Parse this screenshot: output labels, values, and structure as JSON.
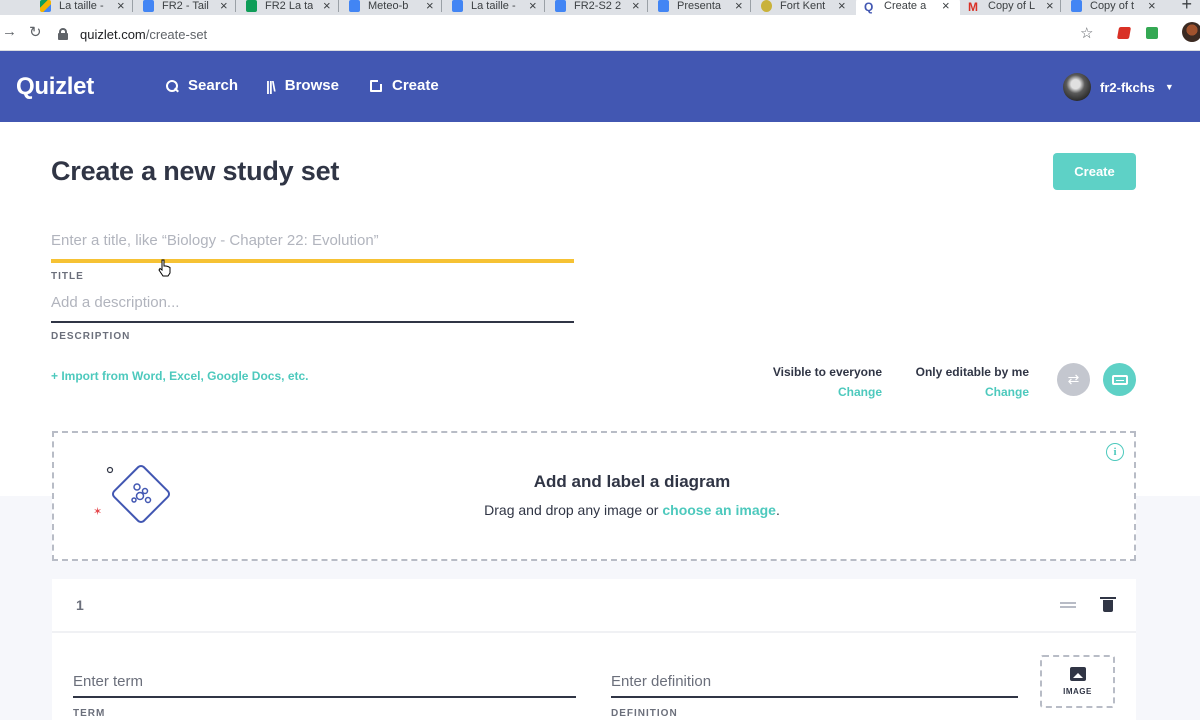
{
  "browser": {
    "tabs": [
      {
        "title": "La taille -",
        "icon": "drive"
      },
      {
        "title": "FR2 - Tail",
        "icon": "docs"
      },
      {
        "title": "FR2 La ta",
        "icon": "sheets"
      },
      {
        "title": "Meteo-b",
        "icon": "docs"
      },
      {
        "title": "La taille -",
        "icon": "docs"
      },
      {
        "title": "FR2-S2 2",
        "icon": "docs"
      },
      {
        "title": "Presenta",
        "icon": "docs"
      },
      {
        "title": "Fort Kent",
        "icon": "kent"
      },
      {
        "title": "Create a",
        "icon": "quizlet",
        "active": true
      },
      {
        "title": "Copy of L",
        "icon": "gmail"
      },
      {
        "title": "Copy of t",
        "icon": "docs"
      }
    ],
    "url_host": "quizlet.com",
    "url_path": "/create-set"
  },
  "header": {
    "logo": "Quizlet",
    "nav": {
      "search": "Search",
      "browse": "Browse",
      "create": "Create"
    },
    "username": "fr2-fkchs"
  },
  "page": {
    "title": "Create a new study set",
    "create_button": "Create",
    "title_field": {
      "placeholder": "Enter a title, like “Biology - Chapter 22: Evolution”",
      "label": "TITLE"
    },
    "description_field": {
      "placeholder": "Add a description...",
      "label": "DESCRIPTION"
    },
    "import_link": "+ Import from Word, Excel, Google Docs, etc.",
    "visibility": {
      "label": "Visible to everyone",
      "change": "Change"
    },
    "editability": {
      "label": "Only editable by me",
      "change": "Change"
    }
  },
  "diagram": {
    "title": "Add and label a diagram",
    "text": "Drag and drop any image or",
    "link": "choose an image",
    "end": "."
  },
  "cards": [
    {
      "number": "1",
      "term_placeholder": "Enter term",
      "term_label": "TERM",
      "definition_placeholder": "Enter definition",
      "definition_label": "DEFINITION",
      "image_label": "IMAGE"
    }
  ],
  "colors": {
    "brand": "#4257b2",
    "accent": "#4dc9bd",
    "title_underline": "#f6c234"
  }
}
